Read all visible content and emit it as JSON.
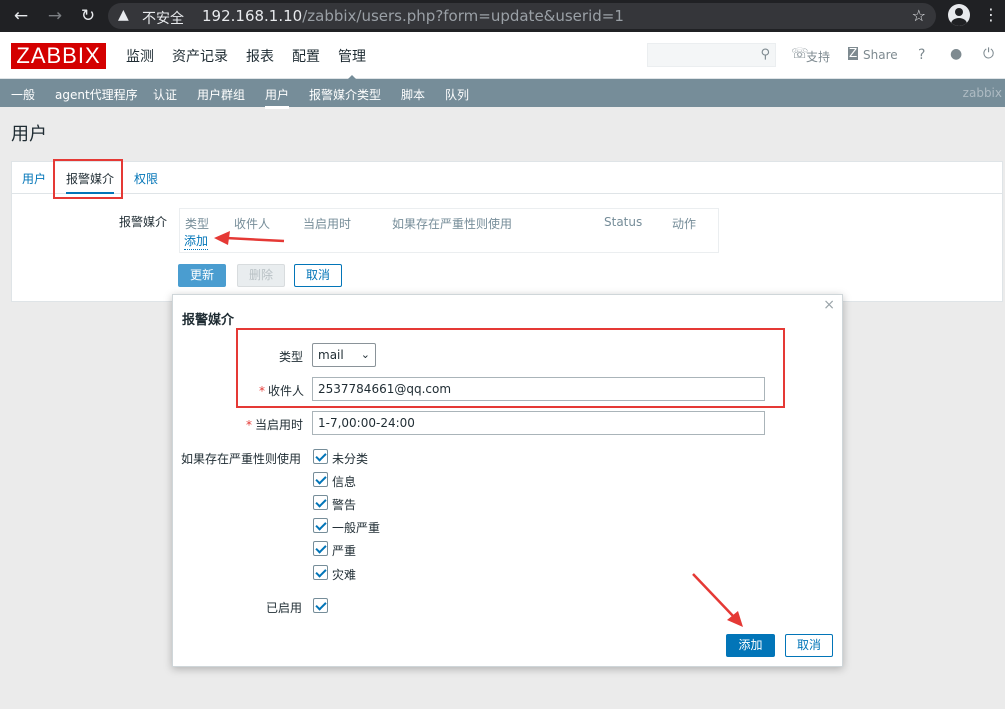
{
  "browser": {
    "back_icon": "arrow-left-icon",
    "forward_icon": "arrow-right-icon",
    "reload_icon": "reload-icon",
    "security_label": "不安全",
    "url_host": "192.168.1.10",
    "url_path": "/zabbix/users.php?form=update&userid=1",
    "bookmark_icon": "star-icon",
    "profile_icon": "profile-icon",
    "menu_icon": "kebab-menu-icon"
  },
  "header": {
    "logo": "ZABBIX",
    "menu": [
      "监测",
      "资产记录",
      "报表",
      "配置",
      "管理"
    ],
    "active_menu": "管理",
    "support": "支持",
    "share": "Share",
    "help": "?"
  },
  "submenu": {
    "items": [
      "一般",
      "agent代理程序",
      "认证",
      "用户群组",
      "用户",
      "报警媒介类型",
      "脚本",
      "队列"
    ],
    "active": "用户",
    "brand": "zabbix"
  },
  "page": {
    "title": "用户"
  },
  "tabs": [
    "用户",
    "报警媒介",
    "权限"
  ],
  "media": {
    "label": "报警媒介",
    "columns": [
      "类型",
      "收件人",
      "当启用时",
      "如果存在严重性则使用",
      "Status",
      "动作"
    ],
    "add_link": "添加"
  },
  "form_buttons": {
    "update": "更新",
    "delete": "删除",
    "cancel": "取消"
  },
  "dialog": {
    "title": "报警媒介",
    "close": "×",
    "type_label": "类型",
    "type_value": "mail",
    "send_to_label": "收件人",
    "send_to_value": "2537784661@qq.com",
    "when_active_label": "当启用时",
    "when_active_value": "1-7,00:00-24:00",
    "severity_label": "如果存在严重性则使用",
    "severities": [
      "未分类",
      "信息",
      "警告",
      "一般严重",
      "严重",
      "灾难"
    ],
    "enabled_label": "已启用",
    "add_button": "添加",
    "cancel_button": "取消"
  },
  "colors": {
    "brand_red": "#d40000",
    "submenu_bg": "#768d99",
    "link_blue": "#0275b8",
    "annotation_red": "#e53935"
  }
}
